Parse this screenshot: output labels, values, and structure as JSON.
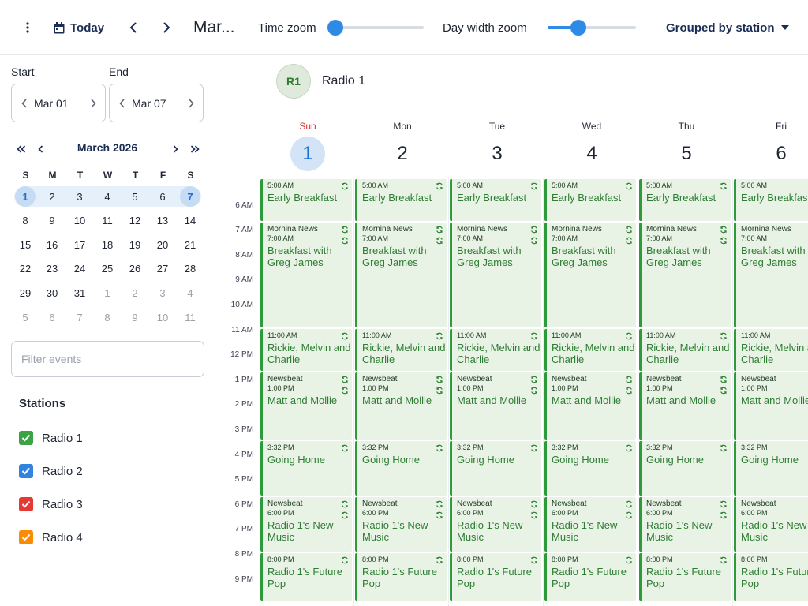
{
  "toolbar": {
    "today_label": "Today",
    "period_title": "Mar...",
    "time_zoom_label": "Time zoom",
    "time_zoom_value": 0.0,
    "day_width_zoom_label": "Day width zoom",
    "day_width_zoom_value": 0.35,
    "grouping_label": "Grouped by station"
  },
  "sidebar": {
    "start_label": "Start",
    "end_label": "End",
    "start_value": "Mar 01",
    "end_value": "Mar 07",
    "mini_calendar": {
      "title": "March 2026",
      "weekday_headers": [
        "S",
        "M",
        "T",
        "W",
        "T",
        "F",
        "S"
      ],
      "weeks": [
        [
          "1",
          "2",
          "3",
          "4",
          "5",
          "6",
          "7"
        ],
        [
          "8",
          "9",
          "10",
          "11",
          "12",
          "13",
          "14"
        ],
        [
          "15",
          "16",
          "17",
          "18",
          "19",
          "20",
          "21"
        ],
        [
          "22",
          "23",
          "24",
          "25",
          "26",
          "27",
          "28"
        ],
        [
          "29",
          "30",
          "31",
          "1",
          "2",
          "3",
          "4"
        ],
        [
          "5",
          "6",
          "7",
          "8",
          "9",
          "10",
          "11"
        ]
      ]
    },
    "filter_placeholder": "Filter events",
    "stations_title": "Stations",
    "stations": [
      {
        "label": "Radio 1",
        "color": "#3aa343",
        "checked": true
      },
      {
        "label": "Radio 2",
        "color": "#2f84e0",
        "checked": true
      },
      {
        "label": "Radio 3",
        "color": "#e53935",
        "checked": true
      },
      {
        "label": "Radio 4",
        "color": "#fb8c00",
        "checked": true
      }
    ]
  },
  "calendar": {
    "resource": {
      "avatar_text": "R1",
      "name": "Radio 1",
      "color": "#2e7d32"
    },
    "days": [
      {
        "name": "Sun",
        "number": "1",
        "today": true
      },
      {
        "name": "Mon",
        "number": "2",
        "today": false
      },
      {
        "name": "Tue",
        "number": "3",
        "today": false
      },
      {
        "name": "Wed",
        "number": "4",
        "today": false
      },
      {
        "name": "Thu",
        "number": "5",
        "today": false
      },
      {
        "name": "Fri",
        "number": "6",
        "today": false
      }
    ],
    "hours": [
      "6 AM",
      "7 AM",
      "8 AM",
      "9 AM",
      "10 AM",
      "11 AM",
      "12 PM",
      "1 PM",
      "2 PM",
      "3 PM",
      "4 PM",
      "5 PM",
      "6 PM",
      "7 PM",
      "8 PM",
      "9 PM"
    ],
    "events": [
      {
        "time": "5:00 AM",
        "title": "Early Breakfast",
        "start": 5.0,
        "end": 6.75
      },
      {
        "pre": "Mornina News",
        "time": "7:00 AM",
        "title": "Breakfast with Greg James",
        "start": 6.75,
        "end": 11.0
      },
      {
        "time": "11:00 AM",
        "title": "Rickie, Melvin and Charlie",
        "start": 11.0,
        "end": 12.75
      },
      {
        "pre": "Newsbeat",
        "time": "1:00 PM",
        "title": "Matt and Mollie",
        "start": 12.75,
        "end": 15.5
      },
      {
        "time": "3:32 PM",
        "title": "Going Home",
        "start": 15.5,
        "end": 17.75
      },
      {
        "pre": "Newsbeat",
        "time": "6:00 PM",
        "title": "Radio 1's New Music",
        "start": 17.75,
        "end": 20.0
      },
      {
        "time": "8:00 PM",
        "title": "Radio 1's Future Pop",
        "start": 20.0,
        "end": 22.0
      }
    ]
  }
}
